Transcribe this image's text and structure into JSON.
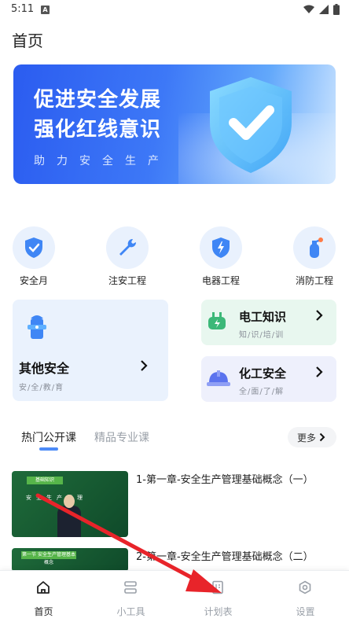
{
  "status_bar": {
    "time": "5:11",
    "notif_letter": "A"
  },
  "header": {
    "title": "首页"
  },
  "banner": {
    "line1": "促进安全发展",
    "line2": "强化红线意识",
    "subtitle": "助力安全生产"
  },
  "categories": [
    {
      "label": "安全月",
      "icon": "shield-check-icon"
    },
    {
      "label": "注安工程",
      "icon": "wrench-icon"
    },
    {
      "label": "电器工程",
      "icon": "lightning-icon"
    },
    {
      "label": "消防工程",
      "icon": "fire-extinguisher-icon"
    }
  ],
  "cards": {
    "other_safety": {
      "title": "其他安全",
      "subtitle": "安/全/教/育",
      "icon": "hydrant-icon"
    },
    "electrical": {
      "title": "电工知识",
      "subtitle": "知/识/培/训",
      "icon": "plug-icon"
    },
    "chemical": {
      "title": "化工安全",
      "subtitle": "全/面/了/解",
      "icon": "helmet-icon"
    }
  },
  "tabs": {
    "active": "热门公开课",
    "inactive": "精品专业课",
    "more": "更多"
  },
  "courses": [
    {
      "title": "1-第一章-安全生产管理基础概念（一）",
      "thumb_tag": "基础知识",
      "thumb_text": "安全生产管理"
    },
    {
      "title": "2-第一章-安全生产管理基础概念（二）",
      "thumb_tag": "第一节 安全生产管理基本概念"
    }
  ],
  "bottom_nav": [
    {
      "label": "首页",
      "icon": "home-icon",
      "active": true
    },
    {
      "label": "小工具",
      "icon": "tools-icon",
      "active": false
    },
    {
      "label": "计划表",
      "icon": "planner-icon",
      "active": false
    },
    {
      "label": "设置",
      "icon": "settings-icon",
      "active": false
    }
  ],
  "colors": {
    "accent": "#4c8af7",
    "annotation": "#e8242a"
  }
}
